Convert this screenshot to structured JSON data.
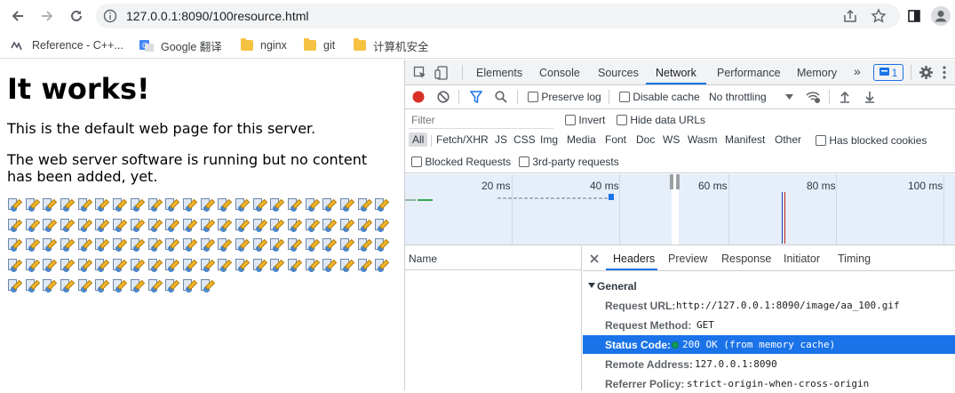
{
  "browser": {
    "url": "127.0.0.1:8090/100resource.html",
    "bookmarks": [
      {
        "label": "Reference - C++...",
        "icon": "cpp-reference-icon"
      },
      {
        "label": "Google 翻译",
        "icon": "google-translate-icon"
      },
      {
        "label": "nginx",
        "icon": "folder-icon"
      },
      {
        "label": "git",
        "icon": "folder-icon"
      },
      {
        "label": "计算机安全",
        "icon": "folder-icon"
      }
    ]
  },
  "page": {
    "heading": "It works!",
    "para1": "This is the default web page for this server.",
    "para2": "The web server software is running but no content has been added, yet.",
    "image_count": 100
  },
  "devtools": {
    "tabs": [
      "Elements",
      "Console",
      "Sources",
      "Network",
      "Performance",
      "Memory"
    ],
    "active_tab": "Network",
    "more": "»",
    "issues_count": "1",
    "preserve_log": "Preserve log",
    "disable_cache": "Disable cache",
    "throttling": "No throttling",
    "filter_placeholder": "Filter",
    "invert": "Invert",
    "hide_data_urls": "Hide data URLs",
    "type_filters": [
      "All",
      "Fetch/XHR",
      "JS",
      "CSS",
      "Img",
      "Media",
      "Font",
      "Doc",
      "WS",
      "Wasm",
      "Manifest",
      "Other"
    ],
    "has_blocked_cookies": "Has blocked cookies",
    "blocked_requests": "Blocked Requests",
    "third_party": "3rd-party requests",
    "timeline_ticks": [
      "20 ms",
      "40 ms",
      "60 ms",
      "80 ms",
      "100 ms"
    ],
    "name_header": "Name",
    "detail_tabs": [
      "Headers",
      "Preview",
      "Response",
      "Initiator",
      "Timing"
    ],
    "active_detail_tab": "Headers",
    "section": "General",
    "general": {
      "request_url_label": "Request URL:",
      "request_url": "http://127.0.0.1:8090/image/aa_100.gif",
      "request_method_label": "Request Method:",
      "request_method": "GET",
      "status_code_label": "Status Code:",
      "status_code": "200 OK (from memory cache)",
      "remote_address_label": "Remote Address:",
      "remote_address": "127.0.0.1:8090",
      "referrer_policy_label": "Referrer Policy:",
      "referrer_policy": "strict-origin-when-cross-origin"
    }
  },
  "colors": {
    "accent": "#1a73e8",
    "record": "#d93025",
    "status_green": "#0f9d58",
    "timeline_bg": "#e6eef9"
  }
}
